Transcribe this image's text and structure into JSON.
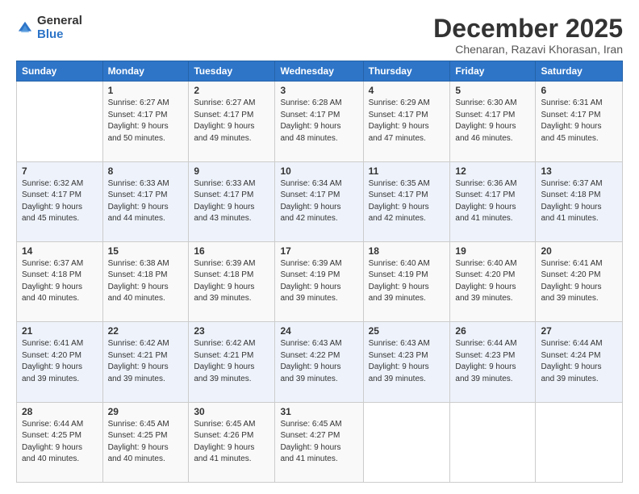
{
  "logo": {
    "general": "General",
    "blue": "Blue"
  },
  "title": "December 2025",
  "subtitle": "Chenaran, Razavi Khorasan, Iran",
  "header": {
    "days": [
      "Sunday",
      "Monday",
      "Tuesday",
      "Wednesday",
      "Thursday",
      "Friday",
      "Saturday"
    ]
  },
  "weeks": [
    [
      {
        "day": "",
        "info": ""
      },
      {
        "day": "1",
        "info": "Sunrise: 6:27 AM\nSunset: 4:17 PM\nDaylight: 9 hours\nand 50 minutes."
      },
      {
        "day": "2",
        "info": "Sunrise: 6:27 AM\nSunset: 4:17 PM\nDaylight: 9 hours\nand 49 minutes."
      },
      {
        "day": "3",
        "info": "Sunrise: 6:28 AM\nSunset: 4:17 PM\nDaylight: 9 hours\nand 48 minutes."
      },
      {
        "day": "4",
        "info": "Sunrise: 6:29 AM\nSunset: 4:17 PM\nDaylight: 9 hours\nand 47 minutes."
      },
      {
        "day": "5",
        "info": "Sunrise: 6:30 AM\nSunset: 4:17 PM\nDaylight: 9 hours\nand 46 minutes."
      },
      {
        "day": "6",
        "info": "Sunrise: 6:31 AM\nSunset: 4:17 PM\nDaylight: 9 hours\nand 45 minutes."
      }
    ],
    [
      {
        "day": "7",
        "info": "Sunrise: 6:32 AM\nSunset: 4:17 PM\nDaylight: 9 hours\nand 45 minutes."
      },
      {
        "day": "8",
        "info": "Sunrise: 6:33 AM\nSunset: 4:17 PM\nDaylight: 9 hours\nand 44 minutes."
      },
      {
        "day": "9",
        "info": "Sunrise: 6:33 AM\nSunset: 4:17 PM\nDaylight: 9 hours\nand 43 minutes."
      },
      {
        "day": "10",
        "info": "Sunrise: 6:34 AM\nSunset: 4:17 PM\nDaylight: 9 hours\nand 42 minutes."
      },
      {
        "day": "11",
        "info": "Sunrise: 6:35 AM\nSunset: 4:17 PM\nDaylight: 9 hours\nand 42 minutes."
      },
      {
        "day": "12",
        "info": "Sunrise: 6:36 AM\nSunset: 4:17 PM\nDaylight: 9 hours\nand 41 minutes."
      },
      {
        "day": "13",
        "info": "Sunrise: 6:37 AM\nSunset: 4:18 PM\nDaylight: 9 hours\nand 41 minutes."
      }
    ],
    [
      {
        "day": "14",
        "info": "Sunrise: 6:37 AM\nSunset: 4:18 PM\nDaylight: 9 hours\nand 40 minutes."
      },
      {
        "day": "15",
        "info": "Sunrise: 6:38 AM\nSunset: 4:18 PM\nDaylight: 9 hours\nand 40 minutes."
      },
      {
        "day": "16",
        "info": "Sunrise: 6:39 AM\nSunset: 4:18 PM\nDaylight: 9 hours\nand 39 minutes."
      },
      {
        "day": "17",
        "info": "Sunrise: 6:39 AM\nSunset: 4:19 PM\nDaylight: 9 hours\nand 39 minutes."
      },
      {
        "day": "18",
        "info": "Sunrise: 6:40 AM\nSunset: 4:19 PM\nDaylight: 9 hours\nand 39 minutes."
      },
      {
        "day": "19",
        "info": "Sunrise: 6:40 AM\nSunset: 4:20 PM\nDaylight: 9 hours\nand 39 minutes."
      },
      {
        "day": "20",
        "info": "Sunrise: 6:41 AM\nSunset: 4:20 PM\nDaylight: 9 hours\nand 39 minutes."
      }
    ],
    [
      {
        "day": "21",
        "info": "Sunrise: 6:41 AM\nSunset: 4:20 PM\nDaylight: 9 hours\nand 39 minutes."
      },
      {
        "day": "22",
        "info": "Sunrise: 6:42 AM\nSunset: 4:21 PM\nDaylight: 9 hours\nand 39 minutes."
      },
      {
        "day": "23",
        "info": "Sunrise: 6:42 AM\nSunset: 4:21 PM\nDaylight: 9 hours\nand 39 minutes."
      },
      {
        "day": "24",
        "info": "Sunrise: 6:43 AM\nSunset: 4:22 PM\nDaylight: 9 hours\nand 39 minutes."
      },
      {
        "day": "25",
        "info": "Sunrise: 6:43 AM\nSunset: 4:23 PM\nDaylight: 9 hours\nand 39 minutes."
      },
      {
        "day": "26",
        "info": "Sunrise: 6:44 AM\nSunset: 4:23 PM\nDaylight: 9 hours\nand 39 minutes."
      },
      {
        "day": "27",
        "info": "Sunrise: 6:44 AM\nSunset: 4:24 PM\nDaylight: 9 hours\nand 39 minutes."
      }
    ],
    [
      {
        "day": "28",
        "info": "Sunrise: 6:44 AM\nSunset: 4:25 PM\nDaylight: 9 hours\nand 40 minutes."
      },
      {
        "day": "29",
        "info": "Sunrise: 6:45 AM\nSunset: 4:25 PM\nDaylight: 9 hours\nand 40 minutes."
      },
      {
        "day": "30",
        "info": "Sunrise: 6:45 AM\nSunset: 4:26 PM\nDaylight: 9 hours\nand 41 minutes."
      },
      {
        "day": "31",
        "info": "Sunrise: 6:45 AM\nSunset: 4:27 PM\nDaylight: 9 hours\nand 41 minutes."
      },
      {
        "day": "",
        "info": ""
      },
      {
        "day": "",
        "info": ""
      },
      {
        "day": "",
        "info": ""
      }
    ]
  ]
}
